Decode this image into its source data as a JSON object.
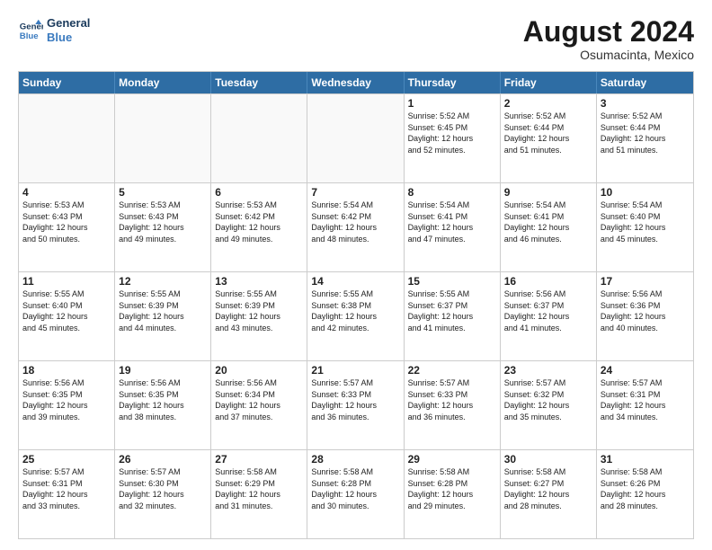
{
  "logo": {
    "line1": "General",
    "line2": "Blue"
  },
  "title": "August 2024",
  "location": "Osumacinta, Mexico",
  "header_days": [
    "Sunday",
    "Monday",
    "Tuesday",
    "Wednesday",
    "Thursday",
    "Friday",
    "Saturday"
  ],
  "weeks": [
    [
      {
        "day": "",
        "info": "",
        "empty": true
      },
      {
        "day": "",
        "info": "",
        "empty": true
      },
      {
        "day": "",
        "info": "",
        "empty": true
      },
      {
        "day": "",
        "info": "",
        "empty": true
      },
      {
        "day": "1",
        "info": "Sunrise: 5:52 AM\nSunset: 6:45 PM\nDaylight: 12 hours\nand 52 minutes."
      },
      {
        "day": "2",
        "info": "Sunrise: 5:52 AM\nSunset: 6:44 PM\nDaylight: 12 hours\nand 51 minutes."
      },
      {
        "day": "3",
        "info": "Sunrise: 5:52 AM\nSunset: 6:44 PM\nDaylight: 12 hours\nand 51 minutes."
      }
    ],
    [
      {
        "day": "4",
        "info": "Sunrise: 5:53 AM\nSunset: 6:43 PM\nDaylight: 12 hours\nand 50 minutes."
      },
      {
        "day": "5",
        "info": "Sunrise: 5:53 AM\nSunset: 6:43 PM\nDaylight: 12 hours\nand 49 minutes."
      },
      {
        "day": "6",
        "info": "Sunrise: 5:53 AM\nSunset: 6:42 PM\nDaylight: 12 hours\nand 49 minutes."
      },
      {
        "day": "7",
        "info": "Sunrise: 5:54 AM\nSunset: 6:42 PM\nDaylight: 12 hours\nand 48 minutes."
      },
      {
        "day": "8",
        "info": "Sunrise: 5:54 AM\nSunset: 6:41 PM\nDaylight: 12 hours\nand 47 minutes."
      },
      {
        "day": "9",
        "info": "Sunrise: 5:54 AM\nSunset: 6:41 PM\nDaylight: 12 hours\nand 46 minutes."
      },
      {
        "day": "10",
        "info": "Sunrise: 5:54 AM\nSunset: 6:40 PM\nDaylight: 12 hours\nand 45 minutes."
      }
    ],
    [
      {
        "day": "11",
        "info": "Sunrise: 5:55 AM\nSunset: 6:40 PM\nDaylight: 12 hours\nand 45 minutes."
      },
      {
        "day": "12",
        "info": "Sunrise: 5:55 AM\nSunset: 6:39 PM\nDaylight: 12 hours\nand 44 minutes."
      },
      {
        "day": "13",
        "info": "Sunrise: 5:55 AM\nSunset: 6:39 PM\nDaylight: 12 hours\nand 43 minutes."
      },
      {
        "day": "14",
        "info": "Sunrise: 5:55 AM\nSunset: 6:38 PM\nDaylight: 12 hours\nand 42 minutes."
      },
      {
        "day": "15",
        "info": "Sunrise: 5:55 AM\nSunset: 6:37 PM\nDaylight: 12 hours\nand 41 minutes."
      },
      {
        "day": "16",
        "info": "Sunrise: 5:56 AM\nSunset: 6:37 PM\nDaylight: 12 hours\nand 41 minutes."
      },
      {
        "day": "17",
        "info": "Sunrise: 5:56 AM\nSunset: 6:36 PM\nDaylight: 12 hours\nand 40 minutes."
      }
    ],
    [
      {
        "day": "18",
        "info": "Sunrise: 5:56 AM\nSunset: 6:35 PM\nDaylight: 12 hours\nand 39 minutes."
      },
      {
        "day": "19",
        "info": "Sunrise: 5:56 AM\nSunset: 6:35 PM\nDaylight: 12 hours\nand 38 minutes."
      },
      {
        "day": "20",
        "info": "Sunrise: 5:56 AM\nSunset: 6:34 PM\nDaylight: 12 hours\nand 37 minutes."
      },
      {
        "day": "21",
        "info": "Sunrise: 5:57 AM\nSunset: 6:33 PM\nDaylight: 12 hours\nand 36 minutes."
      },
      {
        "day": "22",
        "info": "Sunrise: 5:57 AM\nSunset: 6:33 PM\nDaylight: 12 hours\nand 36 minutes."
      },
      {
        "day": "23",
        "info": "Sunrise: 5:57 AM\nSunset: 6:32 PM\nDaylight: 12 hours\nand 35 minutes."
      },
      {
        "day": "24",
        "info": "Sunrise: 5:57 AM\nSunset: 6:31 PM\nDaylight: 12 hours\nand 34 minutes."
      }
    ],
    [
      {
        "day": "25",
        "info": "Sunrise: 5:57 AM\nSunset: 6:31 PM\nDaylight: 12 hours\nand 33 minutes."
      },
      {
        "day": "26",
        "info": "Sunrise: 5:57 AM\nSunset: 6:30 PM\nDaylight: 12 hours\nand 32 minutes."
      },
      {
        "day": "27",
        "info": "Sunrise: 5:58 AM\nSunset: 6:29 PM\nDaylight: 12 hours\nand 31 minutes."
      },
      {
        "day": "28",
        "info": "Sunrise: 5:58 AM\nSunset: 6:28 PM\nDaylight: 12 hours\nand 30 minutes."
      },
      {
        "day": "29",
        "info": "Sunrise: 5:58 AM\nSunset: 6:28 PM\nDaylight: 12 hours\nand 29 minutes."
      },
      {
        "day": "30",
        "info": "Sunrise: 5:58 AM\nSunset: 6:27 PM\nDaylight: 12 hours\nand 28 minutes."
      },
      {
        "day": "31",
        "info": "Sunrise: 5:58 AM\nSunset: 6:26 PM\nDaylight: 12 hours\nand 28 minutes."
      }
    ]
  ]
}
